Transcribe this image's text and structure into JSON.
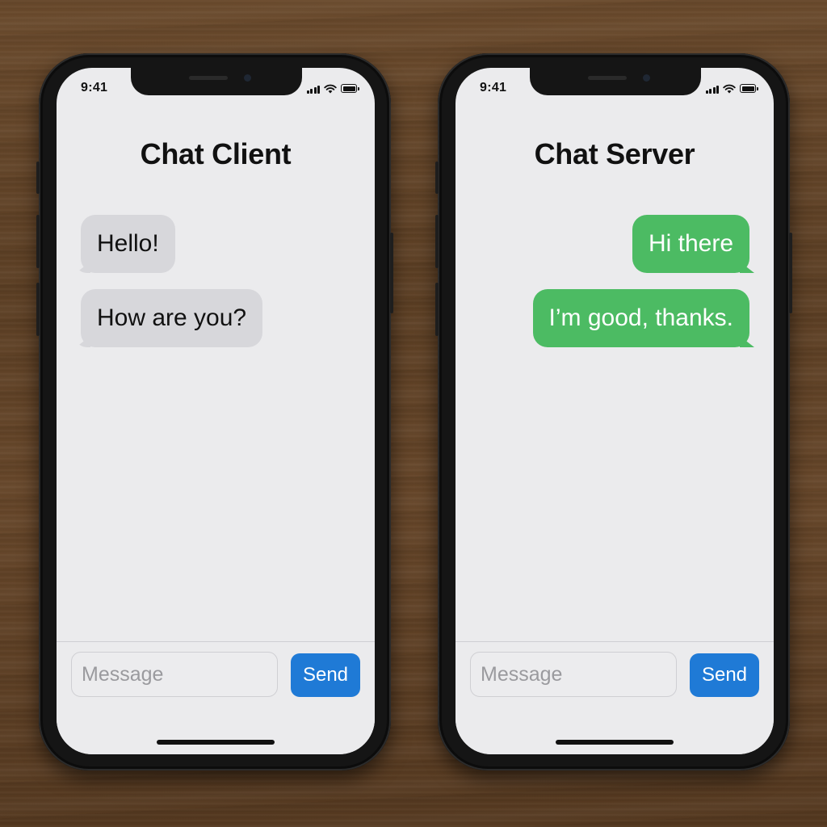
{
  "phones": [
    {
      "status": {
        "time": "9:41",
        "icons": [
          "signal-icon",
          "wifi-icon",
          "battery-icon"
        ]
      },
      "title": "Chat Client",
      "messages": [
        {
          "text": "Hello!",
          "direction": "incoming"
        },
        {
          "text": "How are you?",
          "direction": "incoming"
        }
      ],
      "composer": {
        "placeholder": "Message",
        "send_label": "Send"
      }
    },
    {
      "status": {
        "time": "9:41",
        "icons": [
          "signal-icon",
          "wifi-icon",
          "battery-icon"
        ]
      },
      "title": "Chat Server",
      "messages": [
        {
          "text": "Hi there",
          "direction": "outgoing"
        },
        {
          "text": "I’m good, thanks.",
          "direction": "outgoing"
        }
      ],
      "composer": {
        "placeholder": "Message",
        "send_label": "Send"
      }
    }
  ],
  "colors": {
    "incoming_bubble": "#d7d7db",
    "outgoing_bubble": "#4cbb63",
    "send_button": "#1f7ad6",
    "screen_background": "#ebebed"
  }
}
